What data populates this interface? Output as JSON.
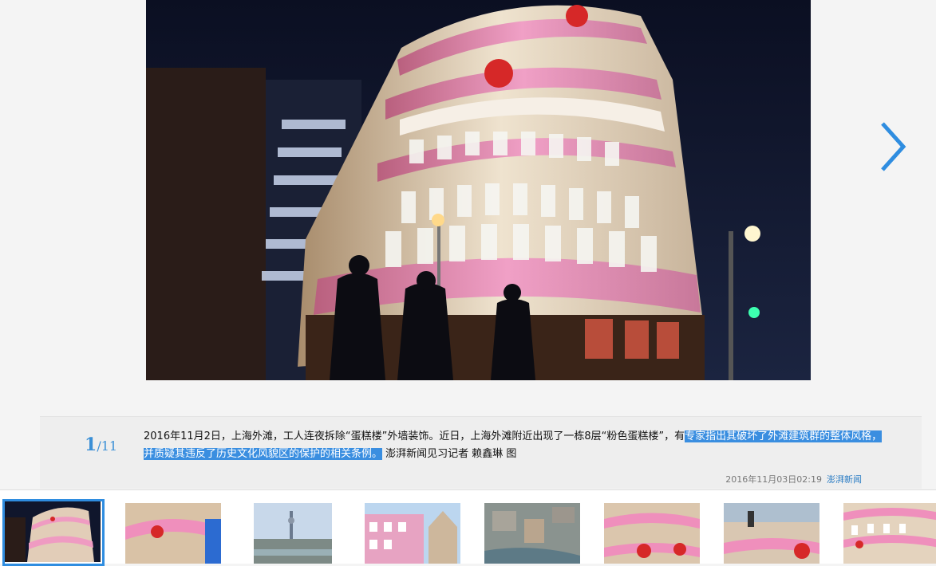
{
  "gallery": {
    "current": "1",
    "separator": "/",
    "total": "11",
    "caption_plain": "2016年11月2日，上海外滩，工人连夜拆除“蛋糕楼”外墙装饰。近日，上海外滩附近出现了一栋8层“粉色蛋糕楼”，有",
    "caption_selected": "专家指出其破坏了外滩建筑群的整体风格，并质疑其违反了历史文化风貌区的保护的相关条例。",
    "caption_credit": " 澎湃新闻见习记者 赖鑫琳 图",
    "date": "2016年11月03日02:19",
    "source": "澎湃新闻"
  },
  "icons": {
    "next": "chevron-right-icon"
  },
  "colors": {
    "accent": "#3a8fd6",
    "selection": "#3a8ee0"
  },
  "thumbnails": [
    {
      "subject": "pink-cake-building-night"
    },
    {
      "subject": "cake-building-facade-closeup"
    },
    {
      "subject": "shanghai-skyline-river"
    },
    {
      "subject": "pink-building-and-church"
    },
    {
      "subject": "aerial-city-view"
    },
    {
      "subject": "cake-building-decorations"
    },
    {
      "subject": "worker-on-facade"
    },
    {
      "subject": "cake-building-windows"
    }
  ]
}
